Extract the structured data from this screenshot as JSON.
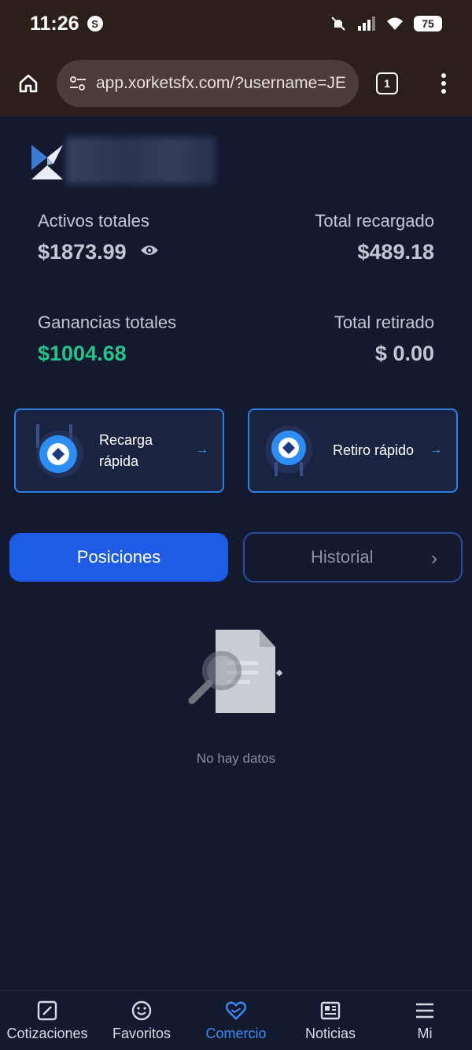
{
  "status_bar": {
    "time": "11:26",
    "app_badge": "S",
    "battery": "75"
  },
  "browser": {
    "url": "app.xorketsfx.com/?username=JE",
    "tab_count": "1"
  },
  "stats": {
    "total_assets_label": "Activos totales",
    "total_assets_value": "$1873.99",
    "total_recharged_label": "Total recargado",
    "total_recharged_value": "$489.18",
    "total_earnings_label": "Ganancias totales",
    "total_earnings_value": "$1004.68",
    "total_withdrawn_label": "Total retirado",
    "total_withdrawn_value": "$ 0.00"
  },
  "actions": {
    "recharge_line1": "Recarga",
    "recharge_line2": "rápida",
    "withdraw_label": "Retiro rápido",
    "arrow": "→"
  },
  "tabs": {
    "positions": "Posiciones",
    "history": "Historial",
    "chevron": "›"
  },
  "empty_state": {
    "text": "No hay datos"
  },
  "nav": {
    "items": [
      {
        "label": "Cotizaciones",
        "icon": "chart-icon"
      },
      {
        "label": "Favoritos",
        "icon": "smile-icon"
      },
      {
        "label": "Comercio",
        "icon": "handshake-heart-icon"
      },
      {
        "label": "Noticias",
        "icon": "news-icon"
      },
      {
        "label": "Mi",
        "icon": "menu-icon"
      }
    ],
    "active_index": 2
  },
  "colors": {
    "background": "#131a30",
    "accent": "#1e5ce6",
    "positive": "#25c28a",
    "card_border": "#2f7fe2"
  }
}
